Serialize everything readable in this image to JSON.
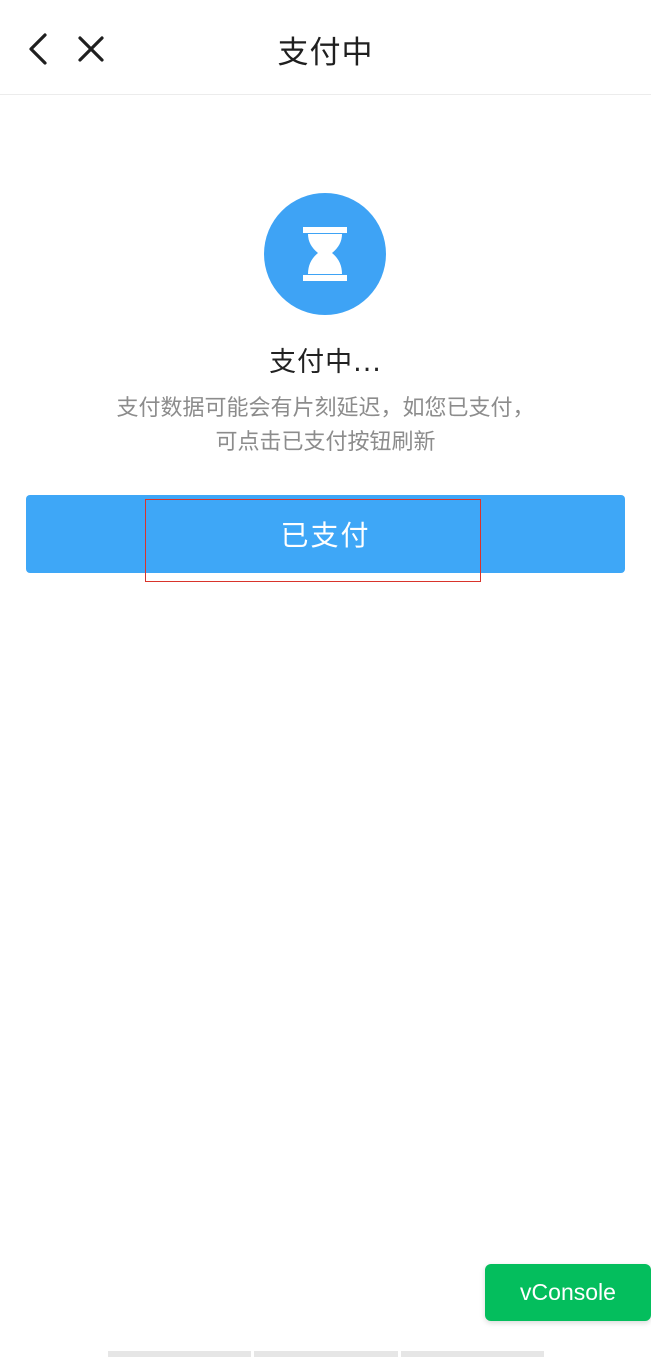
{
  "header": {
    "title": "支付中"
  },
  "status": {
    "icon": "hourglass-icon",
    "title": "支付中...",
    "description_line1": "支付数据可能会有片刻延迟，如您已支付，",
    "description_line2": "可点击已支付按钮刷新"
  },
  "actions": {
    "paid_label": "已支付"
  },
  "debug": {
    "vconsole_label": "vConsole"
  },
  "colors": {
    "accent": "#3ea7f7",
    "vconsole_green": "#04be5d",
    "highlight_red": "#d9342b"
  }
}
